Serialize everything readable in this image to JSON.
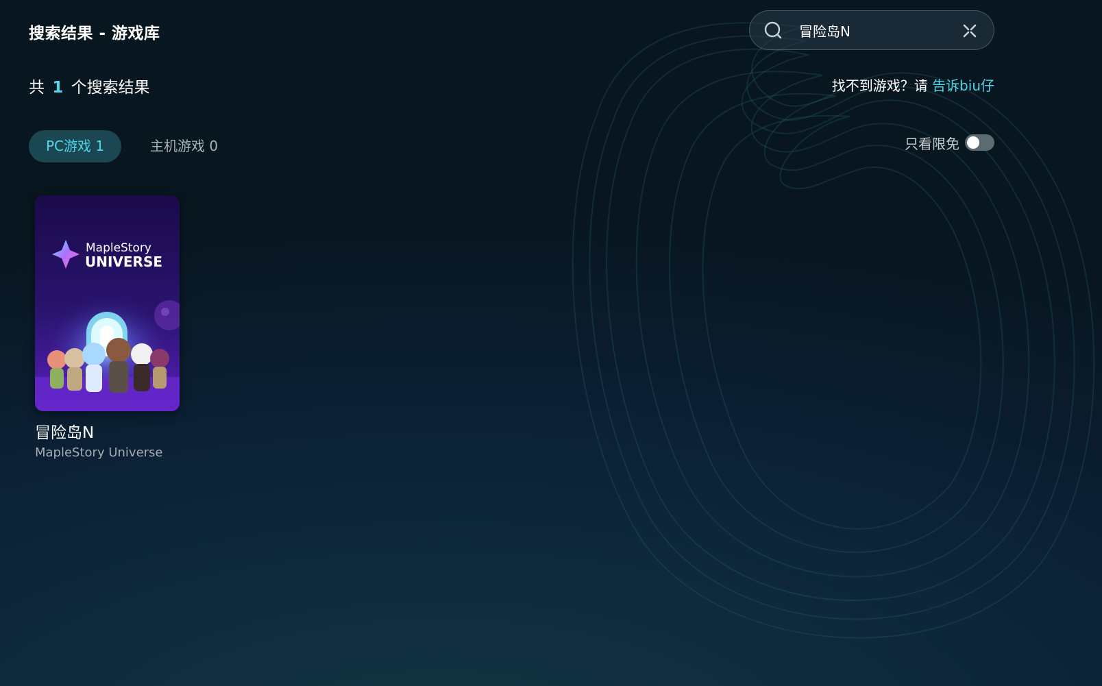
{
  "header": {
    "title": "搜索结果 - 游戏库"
  },
  "search": {
    "value": "冒险岛N",
    "icon": "search-icon",
    "clear_icon": "close-icon"
  },
  "results": {
    "prefix": "共",
    "count": "1",
    "suffix": "个搜索结果"
  },
  "feedback": {
    "text": "找不到游戏？请",
    "link": "告诉biu仔"
  },
  "tabs": [
    {
      "label": "PC游戏 1",
      "active": true
    },
    {
      "label": "主机游戏 0",
      "active": false
    }
  ],
  "filter": {
    "label": "只看限免",
    "enabled": false
  },
  "games": [
    {
      "name": "冒险岛N",
      "subtitle": "MapleStory Universe",
      "cover_logo_line1": "MapleStory",
      "cover_logo_line2": "UNIVERSE"
    }
  ],
  "colors": {
    "accent": "#4fd6e8",
    "tab_active_bg": "#1b4753",
    "cover_purple": "#4b1aa8"
  }
}
